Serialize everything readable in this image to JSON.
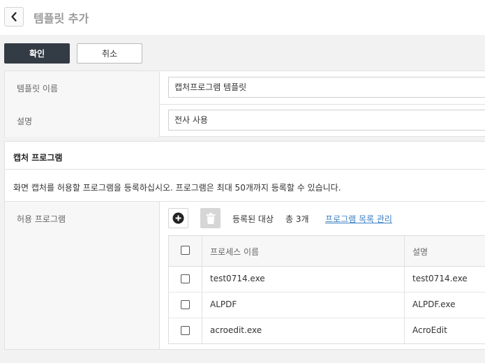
{
  "header": {
    "title": "템플릿 추가"
  },
  "actions": {
    "confirm_label": "확인",
    "cancel_label": "취소"
  },
  "form": {
    "name_label": "템플릿 이름",
    "name_value": "캡처프로그램 템플릿",
    "desc_label": "설명",
    "desc_value": "전사 사용"
  },
  "capture": {
    "section_title": "캡처 프로그램",
    "description": "화면 캡처를 허용할 프로그램을 등록하십시오. 프로그램은 최대 50개까지 등록할 수 있습니다.",
    "allow_label": "허용 프로그램",
    "registered_label": "등록된 대상",
    "registered_count": "총 3개",
    "manage_link": "프로그램 목록 관리",
    "table": {
      "columns": [
        "프로세스 이름",
        "설명"
      ],
      "rows": [
        {
          "process": "test0714.exe",
          "desc": "test0714.exe"
        },
        {
          "process": "ALPDF",
          "desc": "ALPDF.exe"
        },
        {
          "process": "acroedit.exe",
          "desc": "AcroEdit"
        }
      ]
    }
  },
  "icons": {
    "back": "chevron-left-icon",
    "add": "plus-circle-icon",
    "delete": "trash-icon"
  },
  "colors": {
    "primary_button": "#333b44",
    "link": "#3b7fc4",
    "label_bg": "#f7f7f7"
  }
}
